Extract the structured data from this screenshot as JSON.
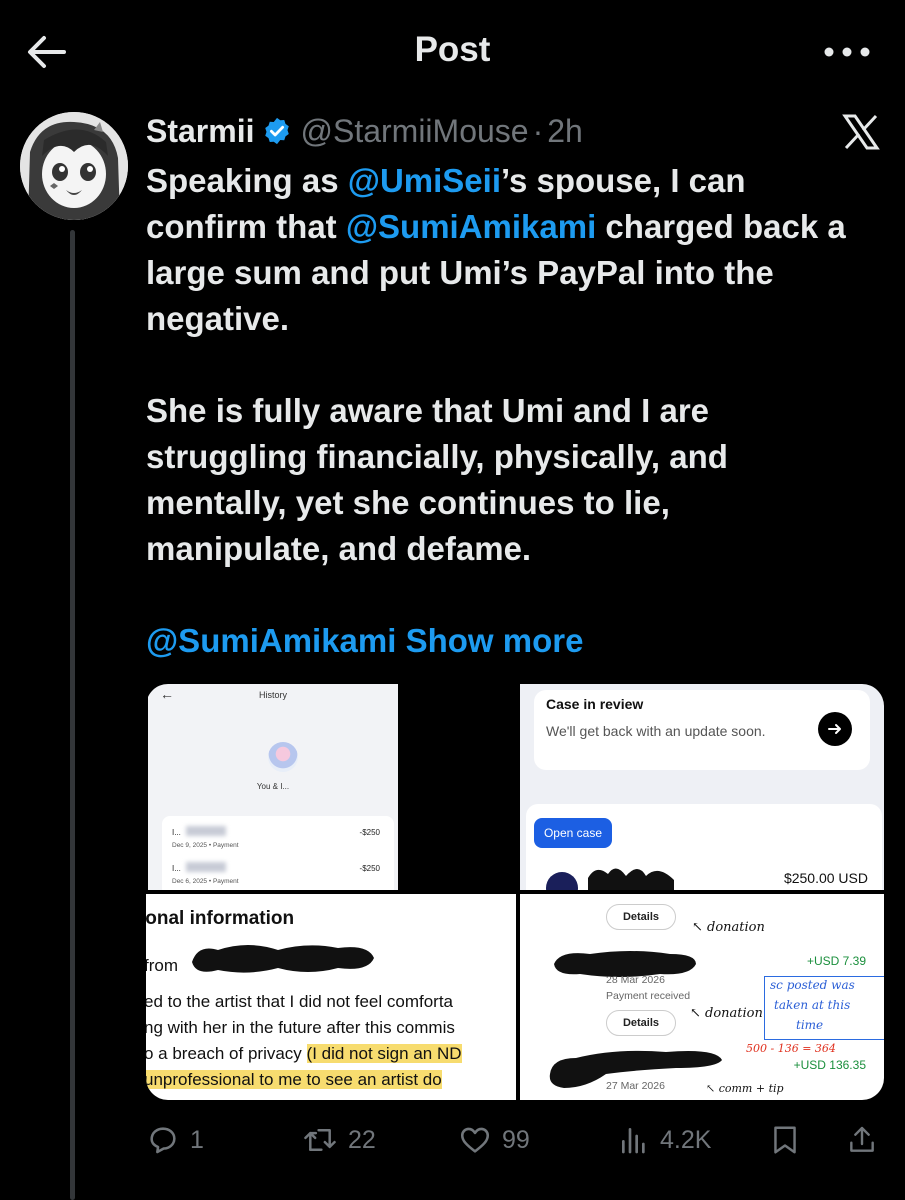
{
  "header": {
    "title": "Post"
  },
  "post": {
    "author": {
      "display_name": "Starmii",
      "handle": "@StarmiiMouse",
      "time": "2h"
    },
    "body": {
      "p1_pre": "Speaking as ",
      "p1_mention1": "@UmiSeii",
      "p1_mid": "’s spouse, I can confirm that ",
      "p1_mention2": "@SumiAmikami",
      "p1_post": " charged back a large sum and put Umi’s PayPal into the negative.",
      "p2": "She is fully aware that Umi and I are struggling financially, physically, and mentally, yet she continues to lie, manipulate, and defame.",
      "p3_mention": "@SumiAmikami",
      "show_more": "Show more"
    },
    "media": {
      "history": {
        "title": "History",
        "you_label": "You & I...",
        "rows": [
          {
            "name": "I...",
            "amount": "-$250",
            "sub": "Dec 9, 2025 • Payment"
          },
          {
            "name": "I...",
            "amount": "-$250",
            "sub": "Dec 6, 2025 • Payment"
          }
        ]
      },
      "case": {
        "title": "Case in review",
        "desc": "We'll get back with an update soon.",
        "open_case": "Open case",
        "amount": "$250.00 USD"
      },
      "info": {
        "heading": "ional information",
        "from": "from",
        "line1": "ed to the artist that I did not feel comforta",
        "line2": "ng with her in the future after this commis",
        "line3_plain": "o a breach of privacy ",
        "line3_hl": "(I did not sign an ND",
        "line4_hl": "unprofessional to me to see an artist do"
      },
      "ledger": {
        "details": "Details",
        "note_donation": "donation",
        "plus1": "+USD 7.39",
        "date1": "28 Mar 2026",
        "payment_received": "Payment received",
        "details2": "Details",
        "note_donation2": "donation",
        "box_text1": "sc posted was",
        "box_text2": "taken at this",
        "box_text3": "time",
        "calc": "500 - 136 = 364",
        "plus2": "+USD 136.35",
        "date2": "27 Mar 2026",
        "note3": "comm + tip"
      }
    },
    "stats": {
      "replies": "1",
      "reposts": "22",
      "likes": "99",
      "views": "4.2K"
    }
  },
  "colors": {
    "background": "#000000",
    "text": "#e7e9ea",
    "muted": "#71767b",
    "accent": "#1d9bf0"
  },
  "icons": [
    "back-arrow-icon",
    "more-icon",
    "verified-badge-icon",
    "x-logo-icon",
    "reply-icon",
    "repost-icon",
    "like-icon",
    "views-icon",
    "bookmark-icon",
    "share-icon"
  ]
}
